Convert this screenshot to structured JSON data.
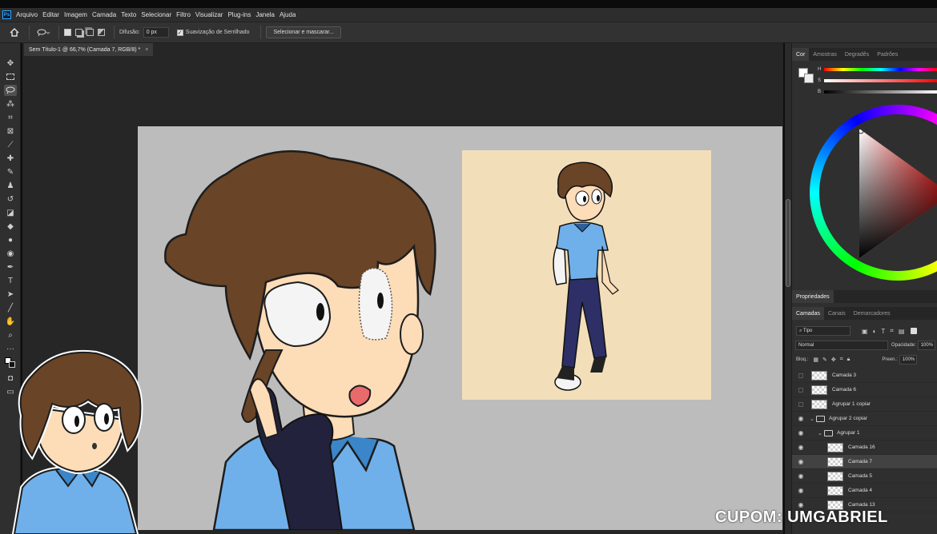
{
  "menubar": {
    "logo": "Ps",
    "items": [
      "Arquivo",
      "Editar",
      "Imagem",
      "Camada",
      "Texto",
      "Selecionar",
      "Filtro",
      "Visualizar",
      "Plug-ins",
      "Janela",
      "Ajuda"
    ]
  },
  "options": {
    "feather_label": "Difusão:",
    "feather_value": "0 px",
    "antialias_label": "Suavização de Serrilhado",
    "select_mask_label": "Selecionar e mascarar..."
  },
  "document": {
    "tab_title": "Sem Título-1 @ 66,7% (Camada 7, RGB/8) *"
  },
  "color_panel": {
    "tabs": [
      "Cor",
      "Amostras",
      "Degradês",
      "Padrões"
    ],
    "slider_labels": [
      "H",
      "S",
      "B"
    ]
  },
  "properties_panel": {
    "tab": "Propriedades"
  },
  "layers_panel": {
    "tabs": [
      "Camadas",
      "Canais",
      "Demarcadores"
    ],
    "filter_label": "Tipo",
    "blend_mode": "Normal",
    "opacity_label": "Opacidade:",
    "opacity_value": "100%",
    "lock_label": "Bloq.:",
    "fill_label": "Preen.:",
    "fill_value": "100%",
    "layers": [
      {
        "name": "Camada 3",
        "visible": false,
        "kind": "layer",
        "indent": 0,
        "selected": false
      },
      {
        "name": "Camada 6",
        "visible": false,
        "kind": "layer",
        "indent": 0,
        "selected": false
      },
      {
        "name": "Agrupar 1 copiar",
        "visible": false,
        "kind": "layer",
        "indent": 0,
        "selected": false
      },
      {
        "name": "Agrupar 2 copiar",
        "visible": true,
        "kind": "group",
        "indent": 0,
        "selected": false
      },
      {
        "name": "Agrupar 1",
        "visible": true,
        "kind": "group",
        "indent": 1,
        "selected": false
      },
      {
        "name": "Camada 16",
        "visible": true,
        "kind": "layer",
        "indent": 2,
        "selected": false
      },
      {
        "name": "Camada 7",
        "visible": true,
        "kind": "layer",
        "indent": 2,
        "selected": true
      },
      {
        "name": "Camada 5",
        "visible": true,
        "kind": "layer",
        "indent": 2,
        "selected": false
      },
      {
        "name": "Camada 4",
        "visible": true,
        "kind": "layer",
        "indent": 2,
        "selected": false
      },
      {
        "name": "Camada 13",
        "visible": true,
        "kind": "layer",
        "indent": 2,
        "selected": false
      }
    ]
  },
  "overlay": {
    "coupon_text": "CUPOM: UMGABRIEL"
  },
  "colors": {
    "canvas_bg": "#bcbcbc",
    "reference_bg": "#f2dfba",
    "hair": "#6a4426",
    "skin": "#fddcb8",
    "shirt": "#6fb0ea",
    "glove": "#23223d",
    "accent": "#31a8ff"
  },
  "tools": [
    "move-icon",
    "marquee-icon",
    "lasso-icon",
    "magic-wand-icon",
    "crop-icon",
    "frame-icon",
    "eyedropper-icon",
    "healing-icon",
    "brush-icon",
    "stamp-icon",
    "history-brush-icon",
    "eraser-icon",
    "bucket-icon",
    "blur-icon",
    "dodge-icon",
    "pen-icon",
    "type-icon",
    "path-select-icon",
    "line-icon",
    "hand-icon",
    "zoom-icon",
    "more-icon"
  ]
}
